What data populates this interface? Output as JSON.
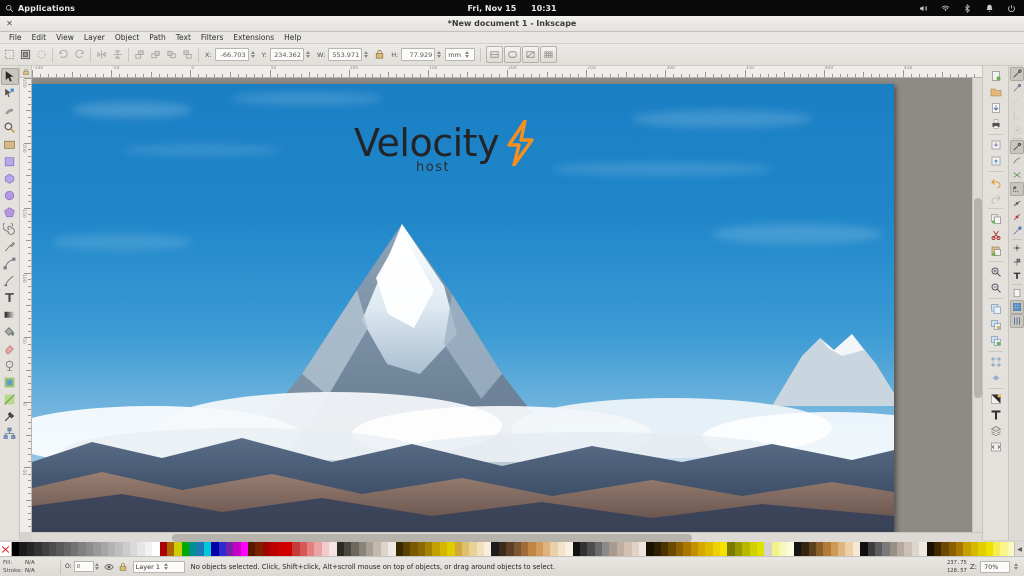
{
  "system_bar": {
    "apps_label": "Applications",
    "search_icon": "search-icon",
    "date": "Fri, Nov 15",
    "time": "10:31",
    "tray": [
      "volume-icon",
      "wifi-icon",
      "bluetooth-icon",
      "notification-bell-icon",
      "power-icon"
    ]
  },
  "window": {
    "title": "*New document 1 - Inkscape",
    "close_label": "✕"
  },
  "menu": {
    "items": [
      "File",
      "Edit",
      "View",
      "Layer",
      "Object",
      "Path",
      "Text",
      "Filters",
      "Extensions",
      "Help"
    ]
  },
  "command_toolbar": {
    "buttons": [
      "new-document-icon",
      "open-document-icon",
      "save-document-icon",
      "undo-icon",
      "redo-icon",
      "copy-icon",
      "paste-icon",
      "zoom-selection-icon",
      "zoom-drawing-icon",
      "zoom-page-icon",
      "zoom-page-width-icon"
    ],
    "x_label": "X:",
    "x_value": "-66.703",
    "y_label": "Y:",
    "y_value": "234.362",
    "w_label": "W:",
    "w_value": "553.971",
    "lock_icon": "lock-aspect-icon",
    "h_label": "H:",
    "h_value": "77.929",
    "unit_value": "mm",
    "toggles": [
      "affect-stroke-width-icon",
      "affect-rounded-corners-icon",
      "affect-gradients-icon",
      "affect-patterns-icon"
    ]
  },
  "toolbox": {
    "tools": [
      {
        "name": "selector-tool",
        "active": true
      },
      {
        "name": "node-editor-tool",
        "active": false
      },
      {
        "name": "tweak-tool",
        "active": false
      },
      {
        "name": "zoom-tool",
        "active": false
      },
      {
        "name": "rectangle-tool",
        "active": false
      },
      {
        "name": "box3d-tool",
        "active": false
      },
      {
        "name": "ellipse-tool",
        "active": false
      },
      {
        "name": "star-tool",
        "active": false
      },
      {
        "name": "spiral-tool",
        "active": false
      },
      {
        "name": "pencil-tool",
        "active": false
      },
      {
        "name": "bezier-pen-tool",
        "active": false
      },
      {
        "name": "calligraphy-tool",
        "active": false
      },
      {
        "name": "text-tool",
        "active": false
      },
      {
        "name": "gradient-tool",
        "active": false
      },
      {
        "name": "paint-bucket-tool",
        "active": false
      },
      {
        "name": "eraser-tool",
        "active": false
      },
      {
        "name": "connector-tool",
        "active": false
      },
      {
        "name": "measure-tool",
        "active": false
      },
      {
        "name": "spray-tool",
        "active": false
      },
      {
        "name": "dropper-tool",
        "active": false
      },
      {
        "name": "diagram-connector-tool",
        "active": false
      }
    ]
  },
  "rulers": {
    "h_numbers": [
      "-100",
      "-50",
      "0",
      "50",
      "100",
      "150",
      "200",
      "250",
      "300",
      "350",
      "400",
      "450"
    ],
    "v_numbers": [
      "250",
      "200",
      "150",
      "100",
      "50",
      "0",
      "-50"
    ]
  },
  "canvas": {
    "artwork_title": "mountain-photo-with-logo",
    "logo": {
      "main_text": "Velocity",
      "sub_text": "host",
      "bolt_icon": "lightning-bolt-icon",
      "bolt_color": "#F5901E",
      "text_color": "#222428"
    },
    "sky_color": "#1f86c9",
    "mountain_color": "#6a6f80"
  },
  "right_dock": {
    "buttons": [
      "new-document-icon",
      "open-document-icon",
      "save-document-icon",
      "print-icon",
      "import-icon",
      "export-icon",
      "undo-icon",
      "redo-icon",
      "copy-icon",
      "cut-icon",
      "paste-icon",
      "zoom-in-icon",
      "zoom-out-icon",
      "duplicate-icon",
      "group-icon",
      "ungroup-icon",
      "object-properties-icon",
      "align-icon",
      "fill-stroke-icon",
      "text-and-font-icon",
      "layers-icon",
      "xml-editor-icon"
    ]
  },
  "snap_bar": {
    "buttons": [
      {
        "name": "snap-enable-icon",
        "on": true
      },
      {
        "name": "snap-bounding-box-icon",
        "on": false
      },
      {
        "name": "snap-bbox-corner-icon",
        "on": false
      },
      {
        "name": "snap-bbox-edge-icon",
        "on": false
      },
      {
        "name": "snap-bbox-midpoint-icon",
        "on": false
      },
      {
        "name": "snap-nodes-icon",
        "on": true
      },
      {
        "name": "snap-path-icon",
        "on": false
      },
      {
        "name": "snap-path-intersection-icon",
        "on": false
      },
      {
        "name": "snap-cusp-node-icon",
        "on": true
      },
      {
        "name": "snap-smooth-node-icon",
        "on": false
      },
      {
        "name": "snap-midpoint-icon",
        "on": false
      },
      {
        "name": "snap-object-center-icon",
        "on": false
      },
      {
        "name": "snap-rotation-center-icon",
        "on": false
      },
      {
        "name": "snap-text-baseline-icon",
        "on": false
      },
      {
        "name": "snap-page-border-icon",
        "on": false
      },
      {
        "name": "snap-grid-icon",
        "on": true
      },
      {
        "name": "snap-guide-icon",
        "on": true
      }
    ]
  },
  "palette": {
    "none_label": "None",
    "scroll_arrow": "◀",
    "colors": [
      "#000000",
      "#1a1a1a",
      "#262626",
      "#333333",
      "#404040",
      "#4d4d4d",
      "#595959",
      "#666666",
      "#737373",
      "#808080",
      "#8c8c8c",
      "#999999",
      "#a6a6a6",
      "#b3b3b3",
      "#bfbfbf",
      "#cccccc",
      "#d9d9d9",
      "#e6e6e6",
      "#f2f2f2",
      "#ffffff",
      "#aa0000",
      "#a86500",
      "#cccc00",
      "#00a800",
      "#008f8f",
      "#1a7ab5",
      "#00c8d7",
      "#0000a8",
      "#2b2bd1",
      "#7a1fa8",
      "#c400c4",
      "#ff00ff",
      "#551a00",
      "#7a2200",
      "#a30000",
      "#bb0000",
      "#cc0000",
      "#d10000",
      "#c43b3b",
      "#d95757",
      "#e58080",
      "#eba3a3",
      "#f2cccc",
      "#f7e3e3",
      "#2b2b22",
      "#4a4740",
      "#6b675d",
      "#8a8378",
      "#a89e91",
      "#c2b8ab",
      "#ddd5cb",
      "#efeae4",
      "#3a2a00",
      "#5c4200",
      "#7a5800",
      "#8a6a00",
      "#a38200",
      "#c2a000",
      "#d4b800",
      "#e0cc00",
      "#cfa93d",
      "#dcc06a",
      "#e8d195",
      "#f0e0bc",
      "#f7eedd",
      "#1c1c1c",
      "#3d2b1a",
      "#5c4026",
      "#7a5632",
      "#a06b3a",
      "#c08443",
      "#d29a5c",
      "#dfb27f",
      "#ead0a8",
      "#f3e3cc",
      "#faf0e2",
      "#121212",
      "#333333",
      "#4d4d4d",
      "#6b6b6b",
      "#8a8a8a",
      "#a89a8f",
      "#bfae9f",
      "#d2c0b2",
      "#e0d2c6",
      "#efe6dd",
      "#1a1200",
      "#2e2000",
      "#4a3300",
      "#6b4a00",
      "#8a6000",
      "#a87700",
      "#c29000",
      "#d6a800",
      "#e0bb00",
      "#eed100",
      "#f5e200",
      "#7a7a00",
      "#9a9a00",
      "#b8b800",
      "#d1d100",
      "#e0e000",
      "#ededoo",
      "#f2f28a",
      "#f7f7b8",
      "#fafadd",
      "#141414",
      "#33240f",
      "#5c3f1c",
      "#8a5f2b",
      "#b37a38",
      "#cf9a55",
      "#e0b57f",
      "#edd0a8",
      "#f7e8d2",
      "#0f0f0f",
      "#3d3d3d",
      "#5c5c5c",
      "#7a7a7a",
      "#998f85",
      "#b5a89c",
      "#ccc0b5",
      "#ded5cc",
      "#efe9e3",
      "#1a1100",
      "#3d2800",
      "#6b4700",
      "#8a5f00",
      "#a87700",
      "#c4a000",
      "#d6b800",
      "#e3cf00",
      "#eee000",
      "#f5ee4a",
      "#f9f48c",
      "#fcf9c0"
    ]
  },
  "status_bar": {
    "fill_label": "Fill:",
    "fill_value": "N/A",
    "stroke_label": "Stroke:",
    "stroke_value": "N/A",
    "opacity_label": "O:",
    "opacity_value": "0",
    "visibility_icon": "eye-icon",
    "lock_icon": "lock-icon",
    "layer_name": "Layer 1",
    "message": "No objects selected. Click, Shift+click, Alt+scroll mouse on top of objects, or drag around objects to select.",
    "cursor_x": "237.75",
    "cursor_y": "128.57",
    "zoom_label": "Z:",
    "zoom_value": "70%"
  }
}
